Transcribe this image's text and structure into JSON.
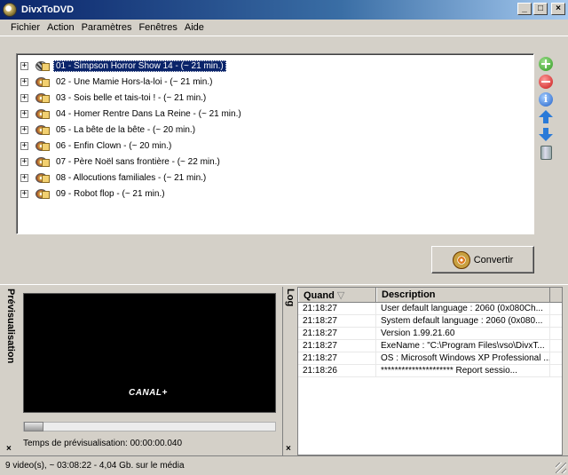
{
  "window": {
    "title": "DivxToDVD"
  },
  "menu": [
    "Fichier",
    "Action",
    "Paramètres",
    "Fenêtres",
    "Aide"
  ],
  "videos": [
    {
      "label": "01 - Simpson Horror Show 14 - (~ 21 min.)",
      "selected": true
    },
    {
      "label": "02 - Une Mamie Hors-la-loi - (~ 21 min.)"
    },
    {
      "label": "03 - Sois belle et tais-toi ! - (~ 21 min.)"
    },
    {
      "label": "04 - Homer Rentre Dans La Reine - (~ 21 min.)"
    },
    {
      "label": "05 - La bête de la bête - (~ 20 min.)"
    },
    {
      "label": "06 - Enfin Clown - (~ 20 min.)"
    },
    {
      "label": "07 - Père Noël sans frontière - (~ 22 min.)"
    },
    {
      "label": "08 - Allocutions familiales - (~ 21 min.)"
    },
    {
      "label": "09 - Robot flop - (~ 21 min.)"
    }
  ],
  "convert_button": {
    "label": "Convertir"
  },
  "preview": {
    "title": "Prévisualisation",
    "channel_logo": "CANAL+",
    "time_label": "Temps de prévisualisation: 00:00:00.040"
  },
  "log": {
    "title": "Log",
    "columns": {
      "when": "Quand",
      "description": "Description"
    },
    "rows": [
      {
        "when": "21:18:27",
        "description": "User default language : 2060 (0x080Ch..."
      },
      {
        "when": "21:18:27",
        "description": "System default language : 2060 (0x080..."
      },
      {
        "when": "21:18:27",
        "description": "Version 1.99.21.60"
      },
      {
        "when": "21:18:27",
        "description": "ExeName : \"C:\\Program Files\\vso\\DivxT..."
      },
      {
        "when": "21:18:27",
        "description": "OS : Microsoft Windows XP Professional ..."
      },
      {
        "when": "21:18:26",
        "description": "********************* Report sessio..."
      }
    ]
  },
  "status": {
    "text": "9 video(s), ~ 03:08:22 - 4,04 Gb. sur le média"
  },
  "window_buttons": {
    "minimize": "_",
    "maximize": "□",
    "close": "×"
  },
  "panel_close_glyph": "×",
  "sort_glyph": "▽",
  "expander_glyph": "+"
}
